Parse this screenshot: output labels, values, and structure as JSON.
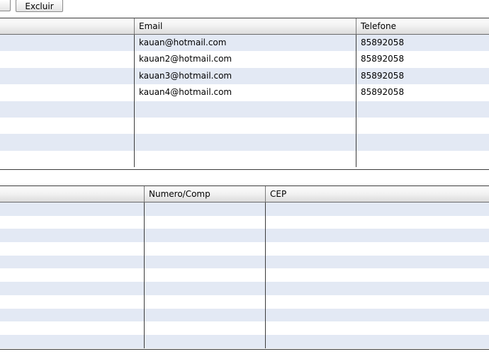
{
  "toolbar": {
    "left_button_label": "",
    "excluir_label": "Excluir"
  },
  "contacts_table": {
    "columns": [
      "",
      "Email",
      "Telefone"
    ],
    "rows": [
      [
        "",
        "kauan@hotmail.com",
        "85892058"
      ],
      [
        "",
        "kauan2@hotmail.com",
        "85892058"
      ],
      [
        "",
        "kauan3@hotmail.com",
        "85892058"
      ],
      [
        "",
        "kauan4@hotmail.com",
        "85892058"
      ],
      [
        "",
        "",
        ""
      ],
      [
        "",
        "",
        ""
      ],
      [
        "",
        "",
        ""
      ],
      [
        "",
        "",
        ""
      ]
    ]
  },
  "address_table": {
    "columns": [
      "",
      "Numero/Comp",
      "CEP"
    ],
    "rows": [
      [
        "",
        "",
        ""
      ],
      [
        "",
        "",
        ""
      ],
      [
        "",
        "",
        ""
      ],
      [
        "",
        "",
        ""
      ],
      [
        "",
        "",
        ""
      ],
      [
        "",
        "",
        ""
      ],
      [
        "",
        "",
        ""
      ],
      [
        "",
        "",
        ""
      ],
      [
        "",
        "",
        ""
      ],
      [
        "",
        "",
        ""
      ],
      [
        "",
        "",
        ""
      ]
    ]
  },
  "colors": {
    "row_alt": "#e3e9f4",
    "row_plain": "#ffffff",
    "grid_line": "#3c3c3c"
  }
}
